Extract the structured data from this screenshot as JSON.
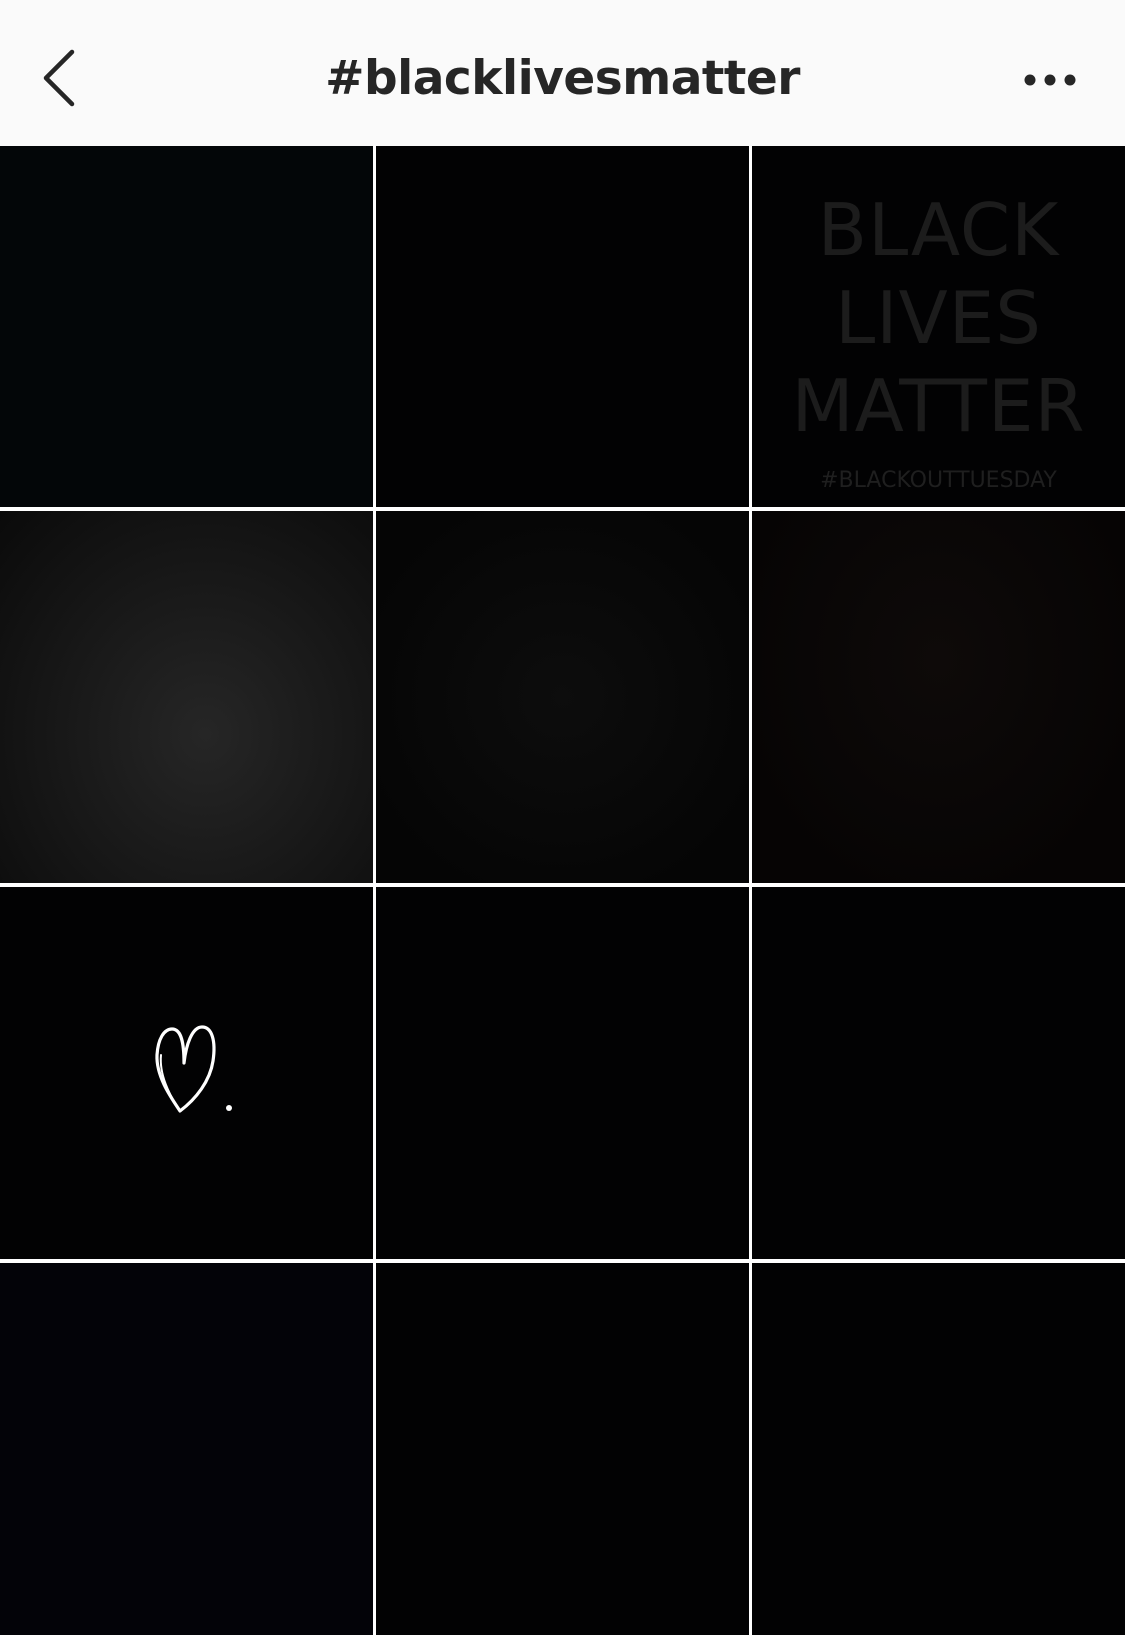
{
  "header": {
    "title": "#blacklivesmatter",
    "back_icon": "chevron-left-icon",
    "more_icon": "more-horizontal-icon",
    "background": "#fafafa",
    "text_color": "#262626"
  },
  "grid": {
    "posts": [
      {
        "kind": "solid-black"
      },
      {
        "kind": "solid-black"
      },
      {
        "kind": "text-graphic",
        "lines": [
          "BLACK",
          "LIVES",
          "MATTER"
        ],
        "hashtag": "#BLACKOUTTUESDAY"
      },
      {
        "kind": "leather-texture"
      },
      {
        "kind": "solid-black"
      },
      {
        "kind": "solid-black"
      },
      {
        "kind": "heart-doodle",
        "icon": "heart-outline-icon"
      },
      {
        "kind": "solid-black"
      },
      {
        "kind": "solid-black"
      },
      {
        "kind": "solid-black"
      },
      {
        "kind": "solid-black"
      },
      {
        "kind": "solid-black"
      }
    ]
  }
}
